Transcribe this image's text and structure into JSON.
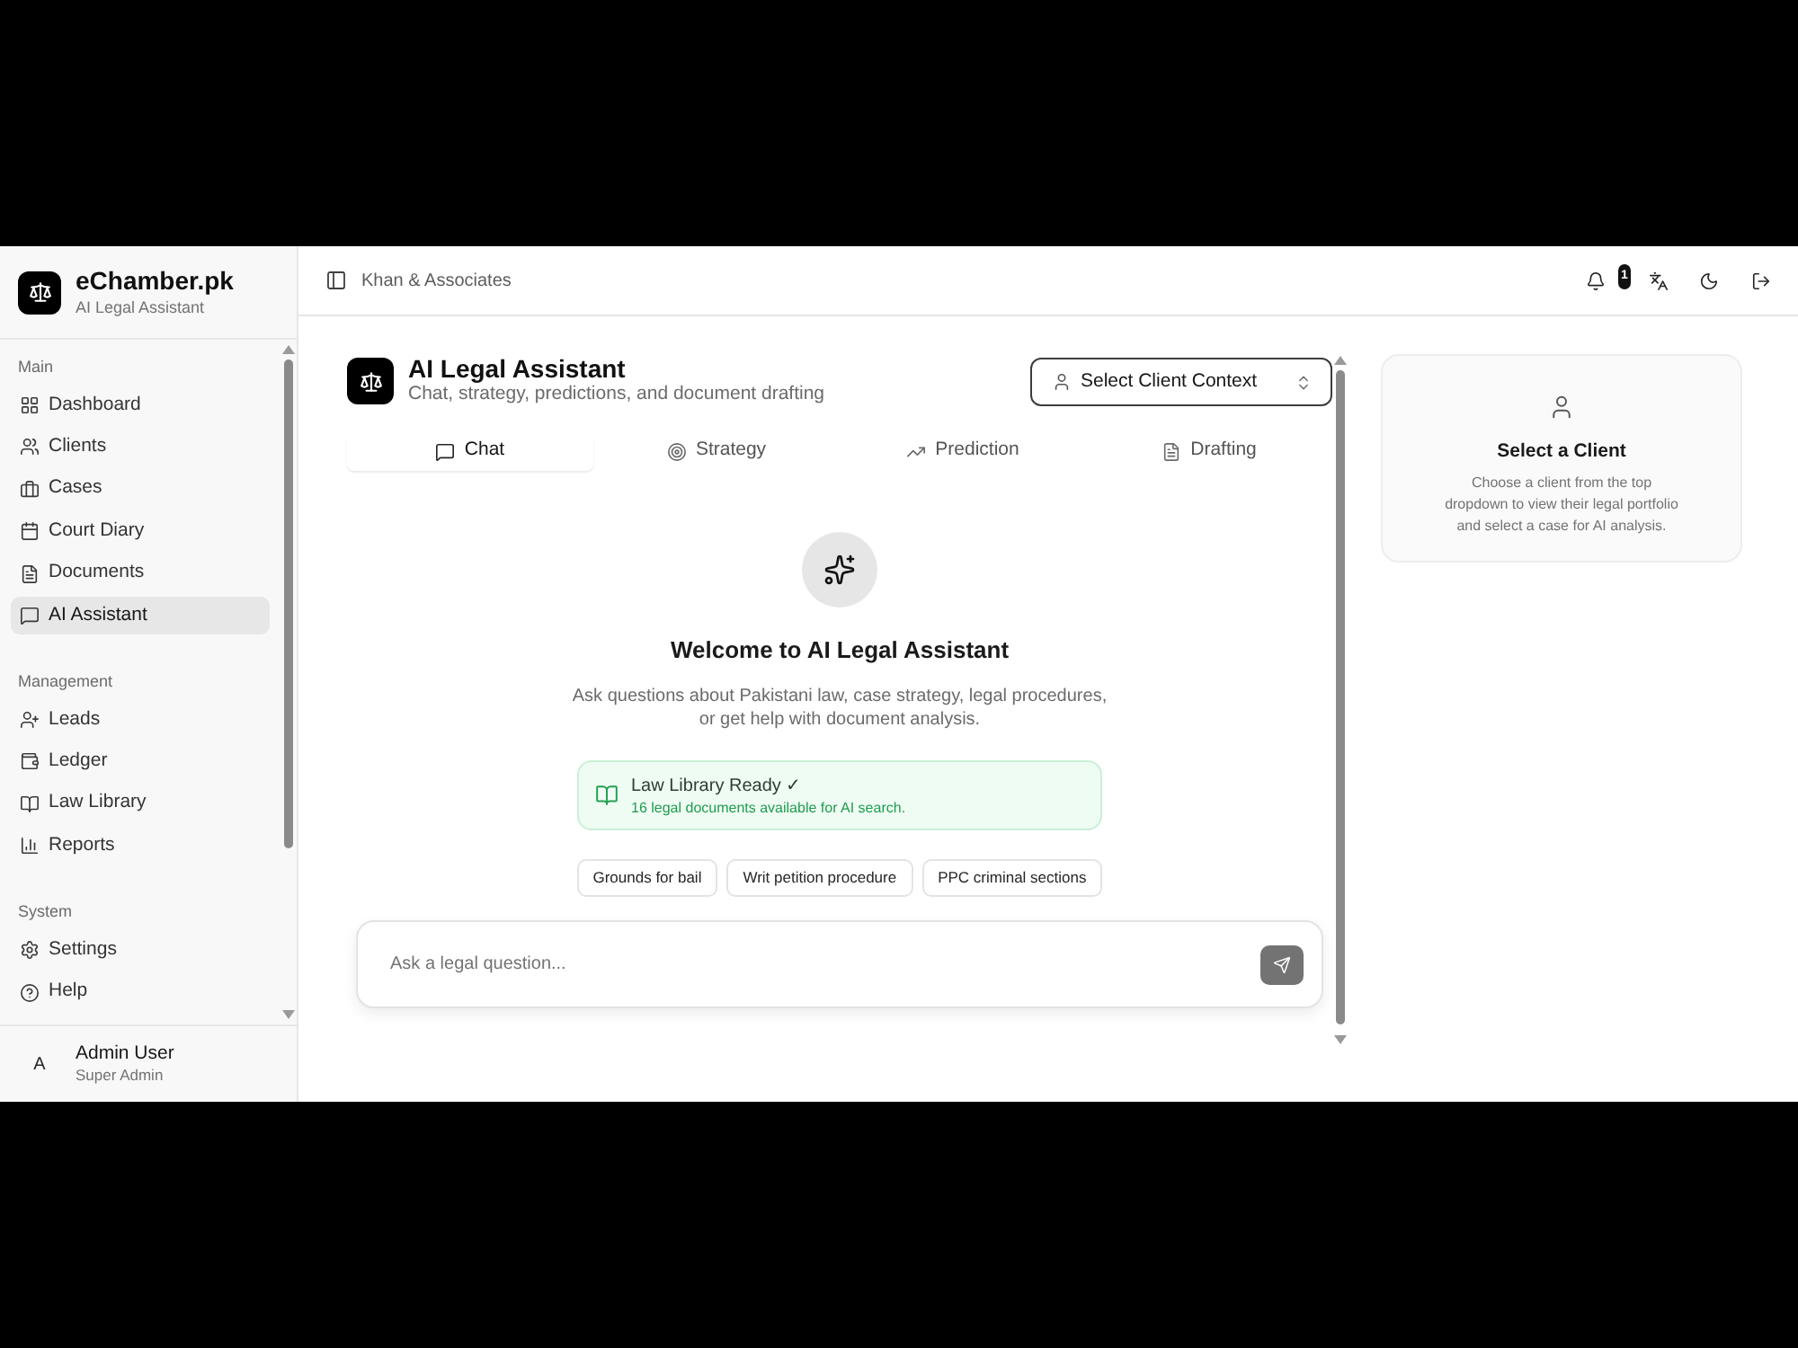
{
  "sidebar": {
    "brand": {
      "title": "eChamber.pk",
      "subtitle": "AI Legal Assistant"
    },
    "sections": [
      {
        "label": "Main",
        "items": [
          {
            "label": "Dashboard",
            "selected": false
          },
          {
            "label": "Clients",
            "selected": false
          },
          {
            "label": "Cases",
            "selected": false
          },
          {
            "label": "Court Diary",
            "selected": false
          },
          {
            "label": "Documents",
            "selected": false
          },
          {
            "label": "AI Assistant",
            "selected": true
          }
        ]
      },
      {
        "label": "Management",
        "items": [
          {
            "label": "Leads",
            "selected": false
          },
          {
            "label": "Ledger",
            "selected": false
          },
          {
            "label": "Law Library",
            "selected": false
          },
          {
            "label": "Reports",
            "selected": false
          }
        ]
      },
      {
        "label": "System",
        "items": [
          {
            "label": "Settings",
            "selected": false
          },
          {
            "label": "Help",
            "selected": false
          }
        ]
      }
    ],
    "user": {
      "initial": "A",
      "name": "Admin User",
      "role": "Super Admin"
    }
  },
  "topbar": {
    "workspace": "Khan & Associates",
    "notification_badge": "1"
  },
  "page": {
    "title": "AI Legal Assistant",
    "subtitle": "Chat, strategy, predictions, and document drafting",
    "client_select": {
      "placeholder": "Select Client Context"
    }
  },
  "tabs": [
    {
      "label": "Chat",
      "selected": true
    },
    {
      "label": "Strategy",
      "selected": false
    },
    {
      "label": "Prediction",
      "selected": false
    },
    {
      "label": "Drafting",
      "selected": false
    }
  ],
  "welcome": {
    "title": "Welcome to AI Legal Assistant",
    "description": "Ask questions about Pakistani law, case strategy, legal procedures, or get help with document analysis.",
    "library": {
      "title": "Law Library Ready ✓",
      "detail": "16 legal documents available for AI search."
    },
    "suggestions": [
      "Grounds for bail",
      "Writ petition procedure",
      "PPC criminal sections"
    ]
  },
  "composer": {
    "placeholder": "Ask a legal question..."
  },
  "client_panel": {
    "title": "Select a Client",
    "description": "Choose a client from the top dropdown to view their legal portfolio and select a case for AI analysis."
  }
}
